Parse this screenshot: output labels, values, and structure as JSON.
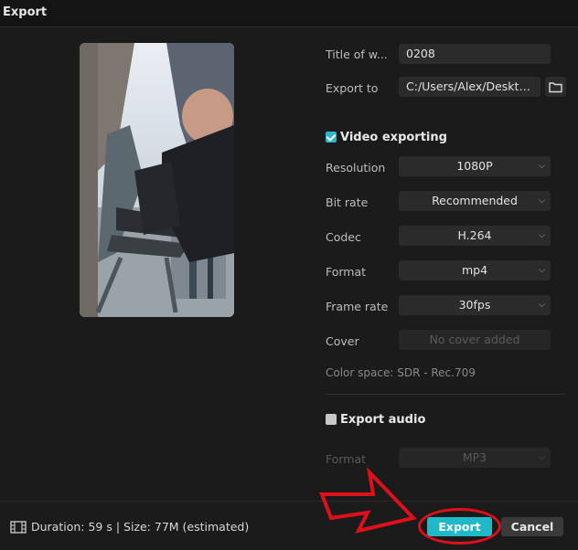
{
  "window": {
    "title": "Export"
  },
  "settings": {
    "title_label": "Title of w...",
    "title_value": "0208",
    "export_to_label": "Export to",
    "export_to_value": "C:/Users/Alex/Deskto...",
    "folder_icon": "folder-icon"
  },
  "video": {
    "section_label": "Video exporting",
    "checked": true,
    "resolution": {
      "label": "Resolution",
      "value": "1080P"
    },
    "bitrate": {
      "label": "Bit rate",
      "value": "Recommended"
    },
    "codec": {
      "label": "Codec",
      "value": "H.264"
    },
    "format": {
      "label": "Format",
      "value": "mp4"
    },
    "framerate": {
      "label": "Frame rate",
      "value": "30fps"
    },
    "cover": {
      "label": "Cover",
      "value": "No cover added"
    },
    "color_space": "Color space: SDR - Rec.709"
  },
  "audio": {
    "section_label": "Export audio",
    "checked": false,
    "format": {
      "label": "Format",
      "value": "MP3"
    }
  },
  "footer": {
    "duration_text": "Duration: 59 s | Size: 77M (estimated)",
    "export_label": "Export",
    "cancel_label": "Cancel"
  },
  "colors": {
    "accent": "#1fb9c7",
    "annotation": "#e0101b",
    "background": "#1b1b1c"
  }
}
